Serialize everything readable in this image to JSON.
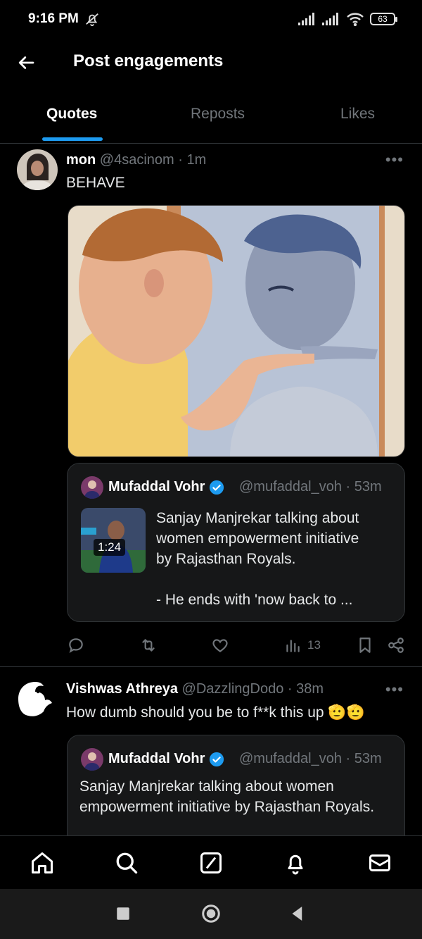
{
  "status_bar": {
    "time": "9:16 PM",
    "battery": "63"
  },
  "header": {
    "title": "Post engagements"
  },
  "tabs": [
    {
      "label": "Quotes",
      "active": true
    },
    {
      "label": "Reposts",
      "active": false
    },
    {
      "label": "Likes",
      "active": false
    }
  ],
  "posts": [
    {
      "display_name": "mon",
      "handle": "@4sacinom",
      "time": "· 1m",
      "text": "BEHAVE",
      "quote": {
        "display_name": "Mufaddal Vohr",
        "handle": "@mufaddal_voh",
        "time": "· 53m",
        "video_duration": "1:24",
        "text_line1": "Sanjay Manjrekar talking about",
        "text_line2": "women empowerment initiative",
        "text_line3": "by Rajasthan Royals.",
        "text_line4": "- He ends with 'now back to ..."
      },
      "actions": {
        "views": "13"
      }
    },
    {
      "display_name": "Vishwas Athreya",
      "handle": "@DazzlingDodo",
      "time": "· 38m",
      "text": "How dumb should you be to f**k this up 🫡🫡",
      "quote": {
        "display_name": "Mufaddal Vohr",
        "handle": "@mufaddal_voh",
        "time": "· 53m",
        "text_line1": "Sanjay Manjrekar talking about women",
        "text_line2": "empowerment initiative by Rajasthan Royals."
      }
    }
  ],
  "colors": {
    "accent": "#1d9bf0",
    "background": "#000000",
    "muted": "#71767b"
  }
}
